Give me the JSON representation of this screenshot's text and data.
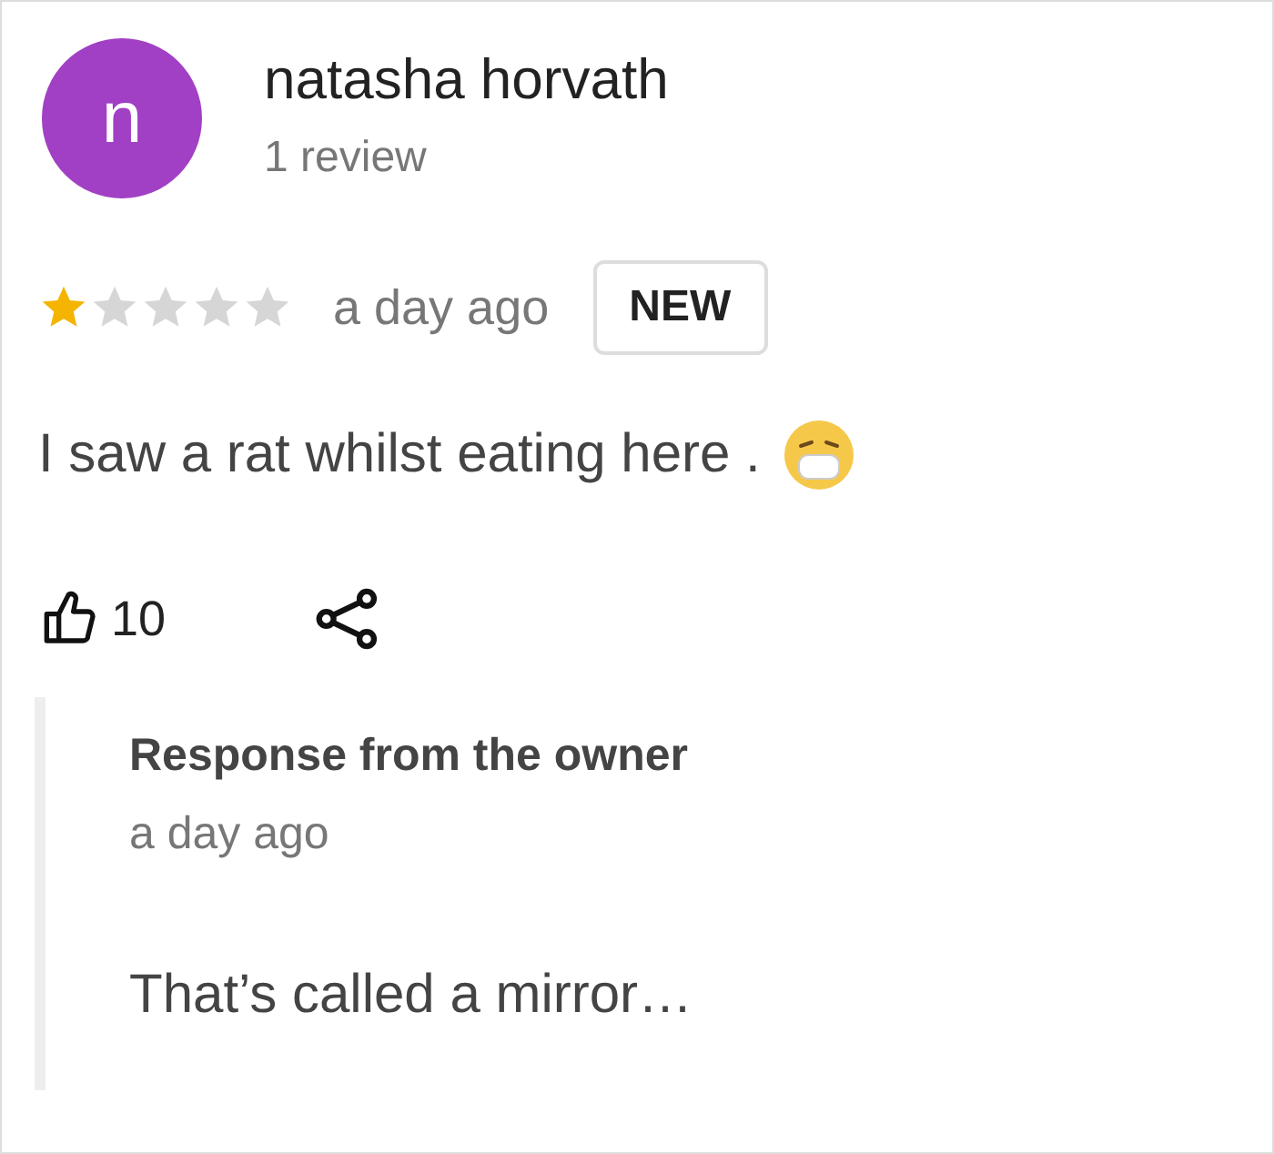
{
  "review": {
    "avatar_letter": "n",
    "author": "natasha horvath",
    "review_count": "1 review",
    "stars": 1,
    "time": "a day ago",
    "badge": "NEW",
    "text": "I saw a rat whilst eating here .",
    "likes": "10"
  },
  "owner_response": {
    "title": "Response from the owner",
    "time": "a day ago",
    "text": "That’s called a mirror…"
  }
}
